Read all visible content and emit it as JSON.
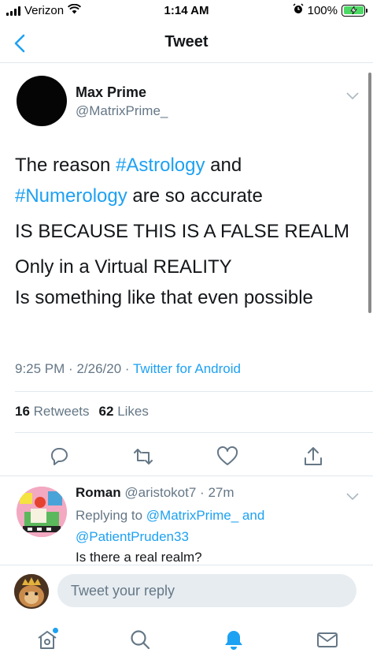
{
  "status_bar": {
    "carrier": "Verizon",
    "time": "1:14 AM",
    "battery_percent": "100%",
    "battery_level": 1.0,
    "icons": [
      "signal-icon",
      "wifi-icon",
      "alarm-icon",
      "battery-charging-icon"
    ]
  },
  "nav": {
    "title": "Tweet",
    "back_icon": "chevron-left-icon"
  },
  "tweet": {
    "author_name": "Max Prime",
    "author_handle": "@MatrixPrime_",
    "text": {
      "line1_before": "The reason ",
      "hashtag1": "#Astrology",
      "line1_mid": " and",
      "hashtag2": "#Numerology",
      "line2_after": " are so accurate",
      "para2": "IS BECAUSE THIS IS A FALSE REALM",
      "para3_line1": "Only in a Virtual REALITY",
      "para3_line2": "Is something like that even possible"
    },
    "time": "9:25 PM",
    "date": "2/26/20",
    "source": "Twitter for Android",
    "retweets_count": "16",
    "retweets_label": "Retweets",
    "likes_count": "62",
    "likes_label": "Likes",
    "actions": [
      "reply-icon",
      "retweet-icon",
      "like-icon",
      "share-icon"
    ]
  },
  "reply": {
    "author_name": "Roman",
    "author_handle": "@aristokot7",
    "age": "27m",
    "replying_prefix": "Replying to",
    "replying_user1": "@MatrixPrime_",
    "replying_and": "and",
    "replying_user2": "@PatientPruden33",
    "text": "Is there a real realm?"
  },
  "compose": {
    "placeholder": "Tweet your reply"
  },
  "tabbar": {
    "tabs": [
      "home-icon",
      "search-icon",
      "notifications-icon",
      "messages-icon"
    ],
    "active": "notifications-icon",
    "accent": "#1da1f2"
  },
  "colors": {
    "accent": "#1da1f2",
    "secondary_text": "#657786",
    "primary_text": "#14171a",
    "divider": "#e1e8ed",
    "battery_fill": "#4cd964"
  }
}
